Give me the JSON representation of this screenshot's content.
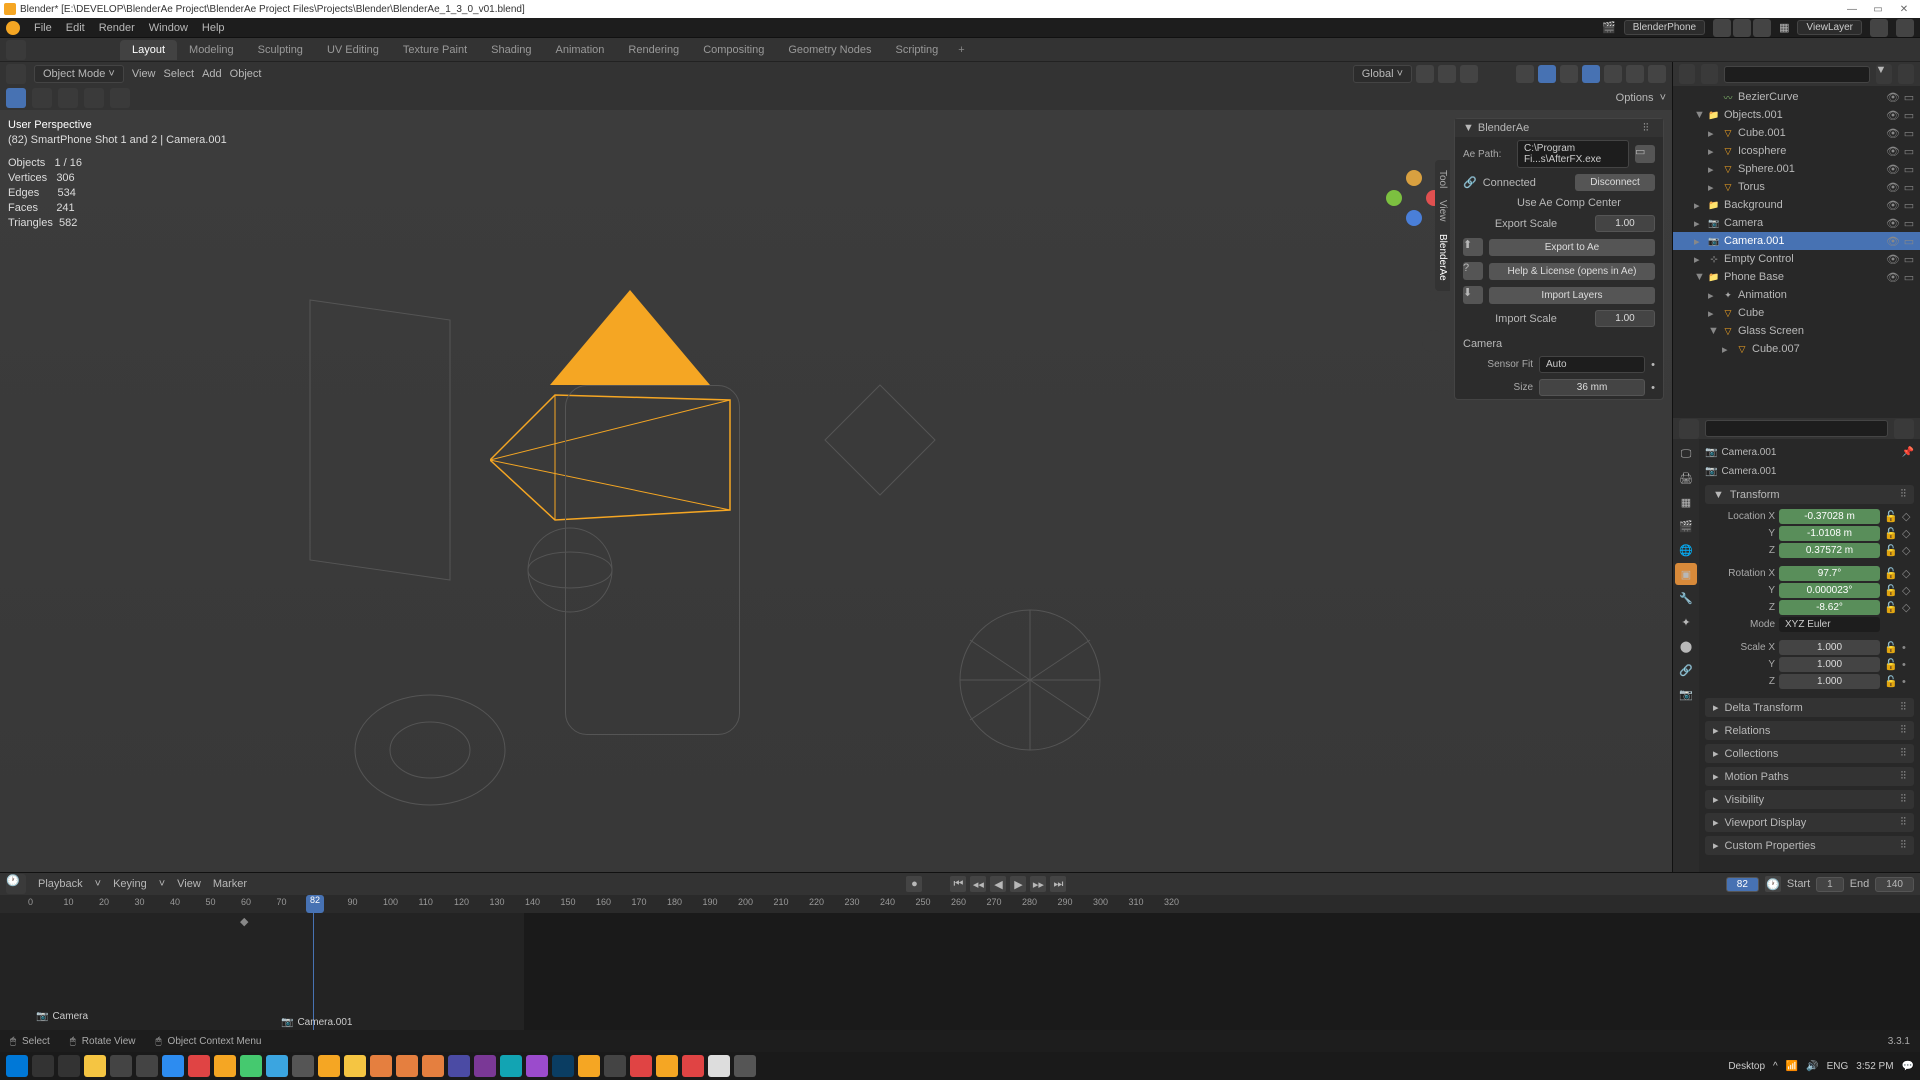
{
  "titlebar": {
    "text": "Blender* [E:\\DEVELOP\\BlenderAe Project\\BlenderAe Project Files\\Projects\\Blender\\BlenderAe_1_3_0_v01.blend]"
  },
  "topmenu": {
    "items": [
      "File",
      "Edit",
      "Render",
      "Window",
      "Help"
    ],
    "scene": "BlenderPhone",
    "viewlayer": "ViewLayer"
  },
  "workspace": {
    "tabs": [
      "Layout",
      "Modeling",
      "Sculpting",
      "UV Editing",
      "Texture Paint",
      "Shading",
      "Animation",
      "Rendering",
      "Compositing",
      "Geometry Nodes",
      "Scripting"
    ],
    "active": 0
  },
  "viewport": {
    "mode": "Object Mode",
    "menus": [
      "View",
      "Select",
      "Add",
      "Object"
    ],
    "orientation": "Global",
    "options_label": "Options",
    "stats": {
      "persp": "User Perspective",
      "scene_line": "(82) SmartPhone Shot 1 and 2 | Camera.001",
      "objects_label": "Objects",
      "objects": "1 / 16",
      "vertices_label": "Vertices",
      "vertices": "306",
      "edges_label": "Edges",
      "edges": "534",
      "faces_label": "Faces",
      "faces": "241",
      "triangles_label": "Triangles",
      "triangles": "582"
    },
    "side_tabs": [
      "Tool",
      "View",
      "BlenderAe"
    ]
  },
  "blenderae": {
    "title": "BlenderAe",
    "ae_path_label": "Ae Path:",
    "ae_path": "C:\\Program Fi...s\\AfterFX.exe",
    "connected_label": "Connected",
    "disconnect": "Disconnect",
    "use_center": "Use Ae Comp Center",
    "export_scale_label": "Export Scale",
    "export_scale": "1.00",
    "export_btn": "Export to Ae",
    "help_btn": "Help & License (opens in Ae)",
    "import_btn": "Import Layers",
    "import_scale_label": "Import Scale",
    "import_scale": "1.00",
    "camera_section": "Camera",
    "sensor_fit_label": "Sensor Fit",
    "sensor_fit": "Auto",
    "size_label": "Size",
    "size": "36 mm"
  },
  "outliner": {
    "tree": [
      {
        "indent": 2,
        "icon": "curve",
        "label": "BezierCurve",
        "sel": false,
        "right": true
      },
      {
        "indent": 1,
        "icon": "coll",
        "label": "Objects.001",
        "sel": false,
        "right": true,
        "toggle": "▼"
      },
      {
        "indent": 2,
        "icon": "mesh",
        "label": "Cube.001",
        "sel": false,
        "right": true,
        "toggle": "▸"
      },
      {
        "indent": 2,
        "icon": "mesh",
        "label": "Icosphere",
        "sel": false,
        "right": true,
        "toggle": "▸"
      },
      {
        "indent": 2,
        "icon": "mesh",
        "label": "Sphere.001",
        "sel": false,
        "right": true,
        "toggle": "▸"
      },
      {
        "indent": 2,
        "icon": "mesh",
        "label": "Torus",
        "sel": false,
        "right": true,
        "toggle": "▸"
      },
      {
        "indent": 1,
        "icon": "coll",
        "label": "Background",
        "sel": false,
        "right": true,
        "toggle": "▸"
      },
      {
        "indent": 1,
        "icon": "cam",
        "label": "Camera",
        "sel": false,
        "right": true,
        "toggle": "▸"
      },
      {
        "indent": 1,
        "icon": "cam",
        "label": "Camera.001",
        "sel": true,
        "right": true,
        "toggle": "▸"
      },
      {
        "indent": 1,
        "icon": "empty",
        "label": "Empty Control",
        "sel": false,
        "right": true,
        "toggle": "▸"
      },
      {
        "indent": 1,
        "icon": "coll",
        "label": "Phone Base",
        "sel": false,
        "right": true,
        "toggle": "▼"
      },
      {
        "indent": 2,
        "icon": "anim",
        "label": "Animation",
        "sel": false,
        "right": false,
        "toggle": "▸"
      },
      {
        "indent": 2,
        "icon": "mesh",
        "label": "Cube",
        "sel": false,
        "right": false,
        "toggle": "▸"
      },
      {
        "indent": 2,
        "icon": "mesh",
        "label": "Glass Screen",
        "sel": false,
        "right": false,
        "toggle": "▼"
      },
      {
        "indent": 3,
        "icon": "mesh",
        "label": "Cube.007",
        "sel": false,
        "right": false,
        "toggle": "▸"
      }
    ]
  },
  "properties": {
    "breadcrumb1": "Camera.001",
    "breadcrumb2": "Camera.001",
    "transform_label": "Transform",
    "loc_label": "Location X",
    "loc_x": "-0.37028 m",
    "loc_y": "-1.0108 m",
    "loc_z": "0.37572 m",
    "rot_label": "Rotation X",
    "rot_x": "97.7°",
    "rot_y": "0.000023°",
    "rot_z": "-8.62°",
    "mode_label": "Mode",
    "mode": "XYZ Euler",
    "scale_label": "Scale X",
    "scale_x": "1.000",
    "scale_y": "1.000",
    "scale_z": "1.000",
    "y_label": "Y",
    "z_label": "Z",
    "sections": [
      "Delta Transform",
      "Relations",
      "Collections",
      "Motion Paths",
      "Visibility",
      "Viewport Display",
      "Custom Properties"
    ]
  },
  "timeline": {
    "menus": [
      "Playback",
      "Keying",
      "View",
      "Marker"
    ],
    "current": "82",
    "start_label": "Start",
    "start": "1",
    "end_label": "End",
    "end": "140",
    "ticks": [
      "0",
      "10",
      "20",
      "30",
      "40",
      "50",
      "60",
      "70",
      "80",
      "90",
      "100",
      "110",
      "120",
      "130",
      "140",
      "150",
      "160",
      "170",
      "180",
      "190",
      "200",
      "210",
      "220",
      "230",
      "240",
      "250",
      "260",
      "270",
      "280",
      "290",
      "300",
      "310",
      "320"
    ],
    "track1": "Camera",
    "track2": "Camera.001"
  },
  "statusbar": {
    "select": "Select",
    "rotate": "Rotate View",
    "context": "Object Context Menu",
    "version": "3.3.1"
  },
  "taskbar": {
    "desktop": "Desktop",
    "lang": "ENG",
    "time": "3:52 PM"
  }
}
